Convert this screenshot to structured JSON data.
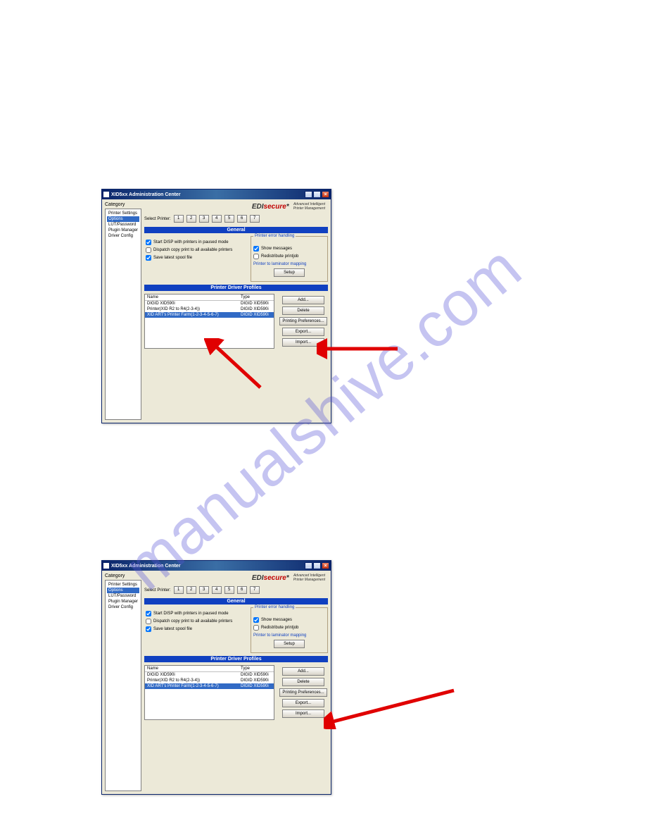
{
  "watermark": "manualshive.com",
  "window": {
    "title": "XID5xx Administration Center",
    "min": "_",
    "max": "□",
    "close": "×"
  },
  "brand": {
    "edi": "EDI",
    "secure": "secure",
    "star": "*",
    "tagline1": "Advanced Intelligent",
    "tagline2": "Printer Management"
  },
  "category_label": "Category",
  "sidebar_items": [
    "Printer Settings",
    "Options",
    "LUT/Password",
    "Plugin Manager",
    "Driver Config"
  ],
  "select_printer": "Select Printer:",
  "printer_buttons": [
    "1",
    "2",
    "3",
    "4",
    "5",
    "6",
    "7"
  ],
  "section_general": "General",
  "section_profiles": "Printer Driver Profiles",
  "checks": {
    "start_disp": "Start DISP with printers in paused mode",
    "dispatch": "Dispatch copy print to all available printers",
    "save_spool": "Save latest spool file"
  },
  "error_group": "Printer error handling",
  "show_messages": "Show messages",
  "redistribute": "Redistribute printjob",
  "laminator_link": "Printer to laminator mapping",
  "setup_btn": "Setup",
  "profile_headers": {
    "name": "Name",
    "type": "Type"
  },
  "profiles": [
    {
      "name": "DIGID XID590i",
      "type": "DIGID XID590i"
    },
    {
      "name": "Printer(XID R2 to R4(2-3-4))",
      "type": "DIGID XID590i"
    },
    {
      "name": "XID ART's Printer Farm(1-2-3-4-5-6-7)",
      "type": "DIGID XID590i"
    }
  ],
  "buttons": {
    "add": "Add...",
    "delete": "Delete",
    "prefs": "Printing Preferences...",
    "export": "Export...",
    "import": "Import..."
  }
}
